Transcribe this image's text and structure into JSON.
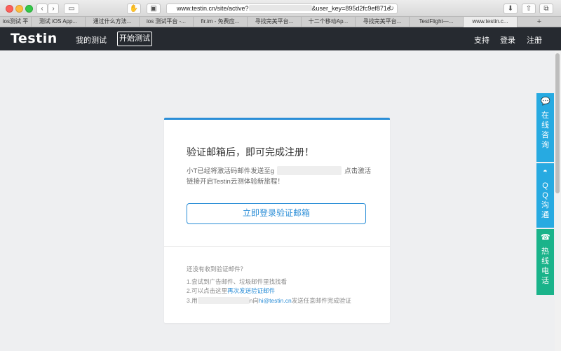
{
  "browser": {
    "back_icon": "chevron-left-icon",
    "forward_icon": "chevron-right-icon",
    "url_prefix": "www.testin.cn/site/active?",
    "url_suffix": "&user_key=895d2fc9ef871e",
    "reload_icon": "reload-icon"
  },
  "tabs": [
    {
      "label": "ios测试 平",
      "active": false
    },
    {
      "label": "测试 iOS App...",
      "active": false
    },
    {
      "label": "通过什么方法...",
      "active": false
    },
    {
      "label": "ios 测试平台 -...",
      "active": false
    },
    {
      "label": "fir.im - 免费应...",
      "active": false
    },
    {
      "label": "寻找完美平台...",
      "active": false
    },
    {
      "label": "十二个移动Ap...",
      "active": false
    },
    {
      "label": "寻找完美平台...",
      "active": false
    },
    {
      "label": "TestFlight—...",
      "active": false
    },
    {
      "label": "www.testin.c...",
      "active": true
    }
  ],
  "header": {
    "logo": "Testin",
    "my_tests": "我的测试",
    "start_test": "开始测试",
    "support": "支持",
    "login": "登录",
    "register": "注册"
  },
  "card": {
    "title": "验证邮箱后，即可完成注册！",
    "text_before": "小T已经将激活码邮件发送至g",
    "text_after": "点击激活链接开启Testin云测体验新旅程！",
    "button": "立即登录验证邮箱",
    "faq_title": "还没有收到验证邮件？",
    "faq1": "1.尝试到广告邮件、垃圾邮件里找找看",
    "faq2_prefix": "2.可以点击这里",
    "faq2_link": "再次发送验证邮件",
    "faq3_prefix": "3.用",
    "faq3_middle": "n向",
    "faq3_link": "hi@testin.cn",
    "faq3_suffix": "发送任意邮件完成验证"
  },
  "side": {
    "chat": "在线咨询",
    "qq": "QQ沟通",
    "phone": "热线电话"
  }
}
